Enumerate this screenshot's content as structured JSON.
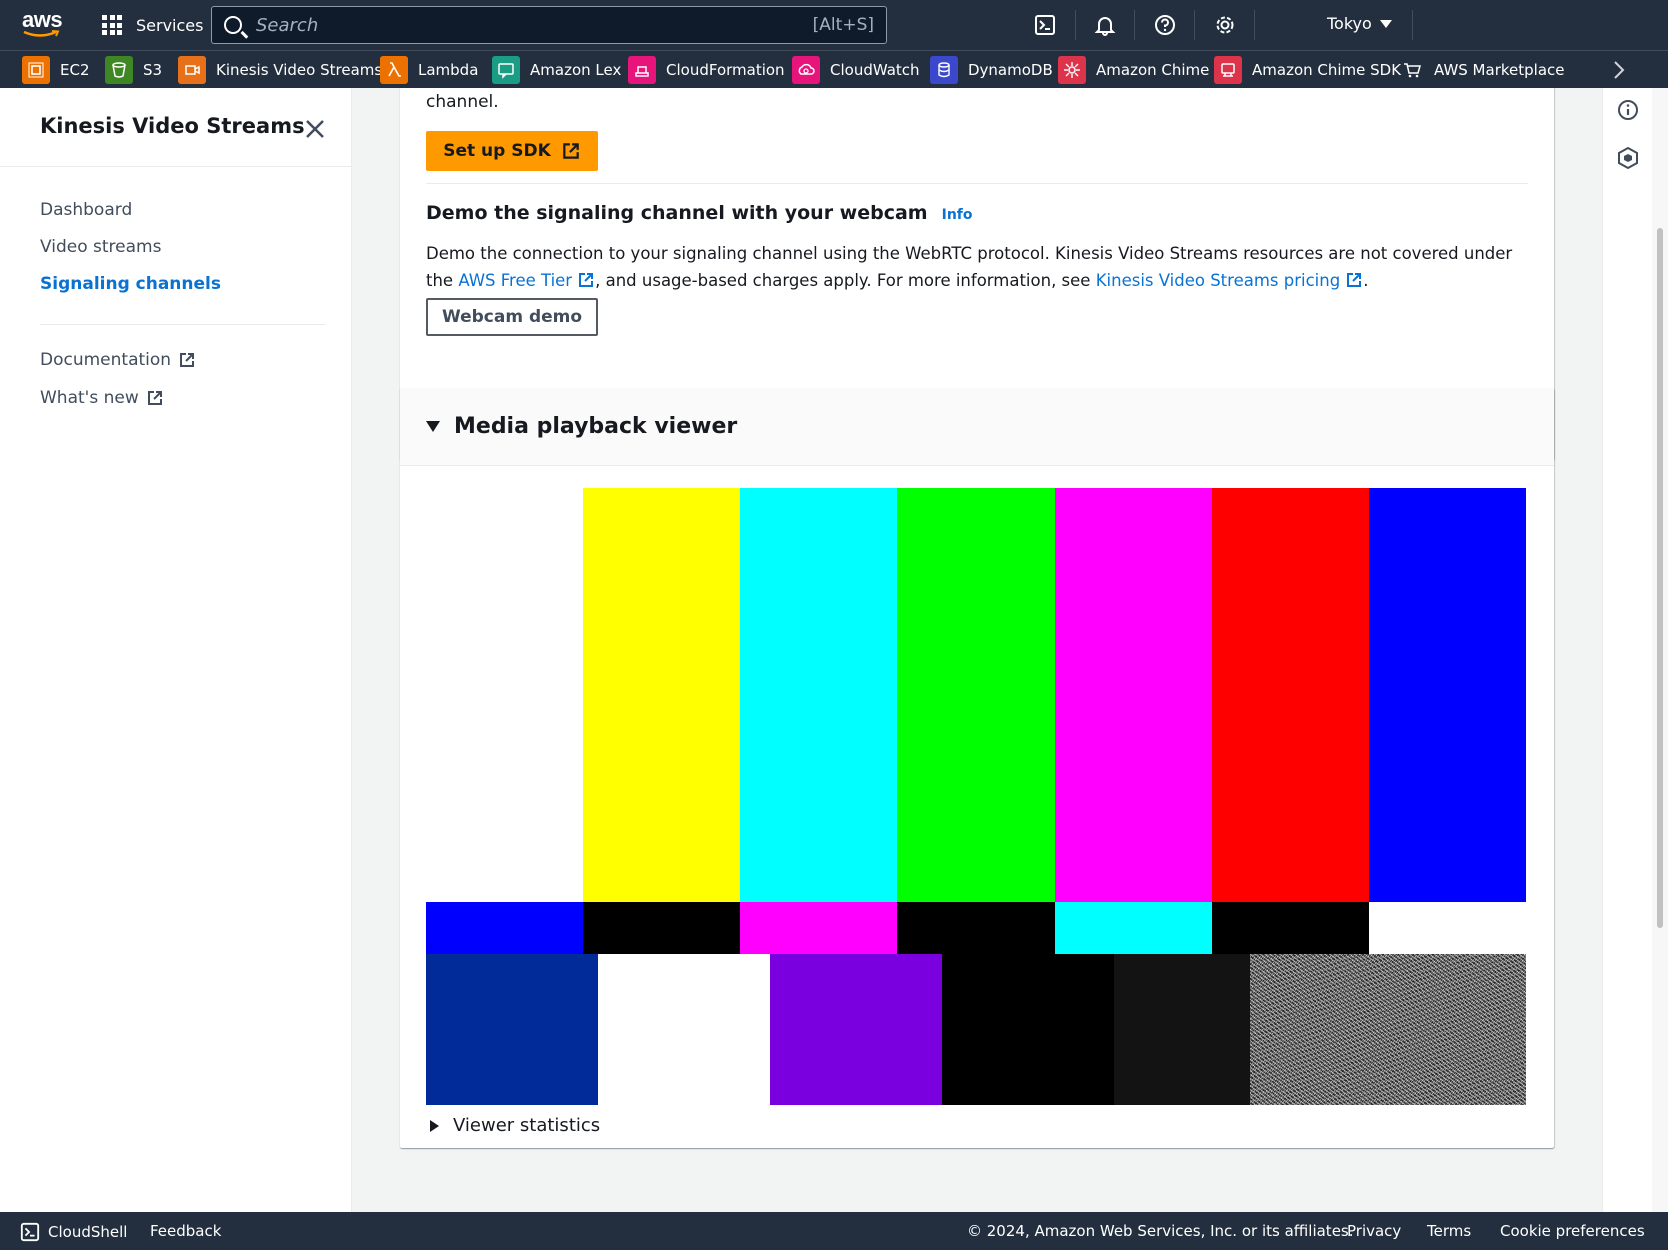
{
  "topnav": {
    "logo_text": "aws",
    "services_label": "Services",
    "search_placeholder": "Search",
    "search_shortcut": "[Alt+S]",
    "region": "Tokyo"
  },
  "favorites": [
    {
      "label": "EC2",
      "color": "#ed7100",
      "icon": "ec2-icon"
    },
    {
      "label": "S3",
      "color": "#3f8624",
      "icon": "s3-icon"
    },
    {
      "label": "Kinesis Video Streams",
      "color": "#e7711b",
      "icon": "kinesis-video-streams-icon"
    },
    {
      "label": "Lambda",
      "color": "#ed7100",
      "icon": "lambda-icon"
    },
    {
      "label": "Amazon Lex",
      "color": "#1b9c85",
      "icon": "amazon-lex-icon"
    },
    {
      "label": "CloudFormation",
      "color": "#e7157b",
      "icon": "cloudformation-icon"
    },
    {
      "label": "CloudWatch",
      "color": "#e7157b",
      "icon": "cloudwatch-icon"
    },
    {
      "label": "DynamoDB",
      "color": "#3b48cc",
      "icon": "dynamodb-icon"
    },
    {
      "label": "Amazon Chime",
      "color": "#dd344c",
      "icon": "amazon-chime-icon"
    },
    {
      "label": "Amazon Chime SDK",
      "color": "#dd344c",
      "icon": "amazon-chime-sdk-icon"
    },
    {
      "label": "AWS Marketplace",
      "color": "#232f3e",
      "icon": "marketplace-cart-icon"
    }
  ],
  "sidebar": {
    "title": "Kinesis Video Streams",
    "items": [
      {
        "label": "Dashboard",
        "active": false
      },
      {
        "label": "Video streams",
        "active": false
      },
      {
        "label": "Signaling channels",
        "active": true
      }
    ],
    "external_links": [
      {
        "label": "Documentation"
      },
      {
        "label": "What's new"
      }
    ]
  },
  "sdk_panel": {
    "top_text": "channel.",
    "setup_button": "Set up SDK",
    "demo_heading": "Demo the signaling channel with your webcam",
    "info_link": "Info",
    "desc_part1": "Demo the connection to your signaling channel using the WebRTC protocol. Kinesis Video Streams resources are not covered under the ",
    "free_tier_link": "AWS Free Tier",
    "desc_part2": ", and usage-based charges apply. For more information, see ",
    "pricing_link": "Kinesis Video Streams pricing",
    "desc_part3": ".",
    "webcam_button": "Webcam demo"
  },
  "media_viewer": {
    "title": "Media playback viewer",
    "viewer_stats_label": "Viewer statistics",
    "test_pattern": {
      "top_colors": [
        "#ffffff",
        "#ffff00",
        "#00ffff",
        "#00ff00",
        "#ff00ff",
        "#ff0000",
        "#0000ff"
      ],
      "middle_colors": [
        "#0000ff",
        "#000000",
        "#ff00ff",
        "#000000",
        "#00ffff",
        "#000000",
        "#ffffff"
      ],
      "bottom_colors": [
        "#002b99",
        "#ffffff",
        "#7a00e0",
        "#000000",
        "#131313"
      ]
    }
  },
  "footer": {
    "cloudshell": "CloudShell",
    "feedback": "Feedback",
    "copyright": "© 2024, Amazon Web Services, Inc. or its affiliates.",
    "privacy": "Privacy",
    "terms": "Terms",
    "cookies": "Cookie preferences"
  }
}
